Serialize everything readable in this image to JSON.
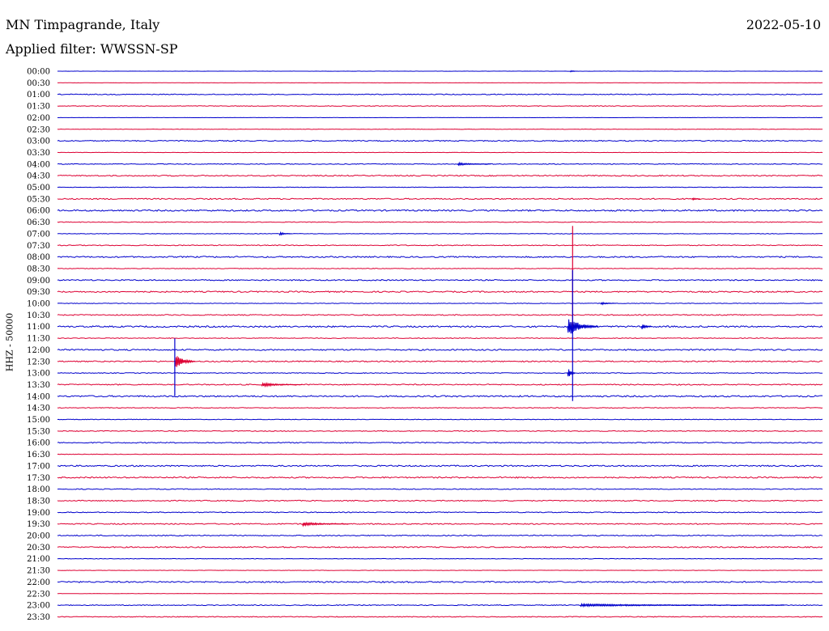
{
  "header": {
    "station": "MN Timpagrande, Italy",
    "date": "2022-05-10",
    "filter": "Applied filter: WWSSN-SP"
  },
  "colors": {
    "even_row": "#0000cc",
    "odd_row": "#dd0033"
  },
  "chart_data": {
    "type": "line",
    "title": "MN Timpagrande, Italy",
    "ylabel": "HHZ - 50000",
    "row_labels": [
      "00:00",
      "00:30",
      "01:00",
      "01:30",
      "02:00",
      "02:30",
      "03:00",
      "03:30",
      "04:00",
      "04:30",
      "05:00",
      "05:30",
      "06:00",
      "06:30",
      "07:00",
      "07:30",
      "08:00",
      "08:30",
      "09:00",
      "09:30",
      "10:00",
      "10:30",
      "11:00",
      "11:30",
      "12:00",
      "12:30",
      "13:00",
      "13:30",
      "14:00",
      "14:30",
      "15:00",
      "15:30",
      "16:00",
      "16:30",
      "17:00",
      "17:30",
      "18:00",
      "18:30",
      "19:00",
      "19:30",
      "20:00",
      "20:30",
      "21:00",
      "21:30",
      "22:00",
      "22:30",
      "23:00",
      "23:30"
    ],
    "row_interval_minutes": 30,
    "row_noise": [
      0.2,
      0.3,
      1.0,
      0.7,
      0.3,
      0.5,
      1.2,
      0.4,
      0.9,
      1.3,
      0.6,
      1.4,
      1.8,
      0.8,
      0.6,
      1.0,
      1.6,
      0.7,
      1.4,
      1.6,
      0.7,
      1.2,
      1.8,
      0.9,
      1.6,
      1.4,
      0.9,
      1.3,
      1.8,
      0.8,
      0.7,
      1.0,
      1.2,
      0.6,
      1.6,
      1.6,
      1.0,
      1.2,
      1.0,
      1.3,
      1.2,
      1.4,
      0.6,
      0.4,
      1.6,
      0.4,
      1.0,
      1.0
    ],
    "events": [
      {
        "row": 0,
        "start_min": 20.1,
        "dur_min": 0.3,
        "amp": 1.5
      },
      {
        "row": 8,
        "start_min": 15.7,
        "dur_min": 1.3,
        "amp": 1.8
      },
      {
        "row": 11,
        "start_min": 24.9,
        "dur_min": 0.3,
        "amp": 2.0
      },
      {
        "row": 14,
        "start_min": 8.7,
        "dur_min": 0.5,
        "amp": 2.0
      },
      {
        "row": 20,
        "start_min": 21.3,
        "dur_min": 0.6,
        "amp": 1.8
      },
      {
        "row": 22,
        "start_min": 20.0,
        "dur_min": 1.2,
        "amp": 14
      },
      {
        "row": 22,
        "start_min": 22.9,
        "dur_min": 0.4,
        "amp": 5
      },
      {
        "row": 25,
        "start_min": 4.6,
        "dur_min": 0.8,
        "amp": 10
      },
      {
        "row": 26,
        "start_min": 20.0,
        "dur_min": 0.3,
        "amp": 9
      },
      {
        "row": 27,
        "start_min": 8.0,
        "dur_min": 1.6,
        "amp": 2.5
      },
      {
        "row": 39,
        "start_min": 9.6,
        "dur_min": 1.8,
        "amp": 2.5
      },
      {
        "row": 46,
        "start_min": 20.5,
        "dur_min": 8.0,
        "amp": 1.6
      }
    ],
    "spikes": [
      {
        "row": 21,
        "minute": 20.2,
        "up": 110,
        "down": 15
      },
      {
        "row": 22,
        "minute": 20.2,
        "up": 70,
        "down": 92
      },
      {
        "row": 24,
        "minute": 4.6,
        "up": 14,
        "down": 57
      }
    ]
  }
}
